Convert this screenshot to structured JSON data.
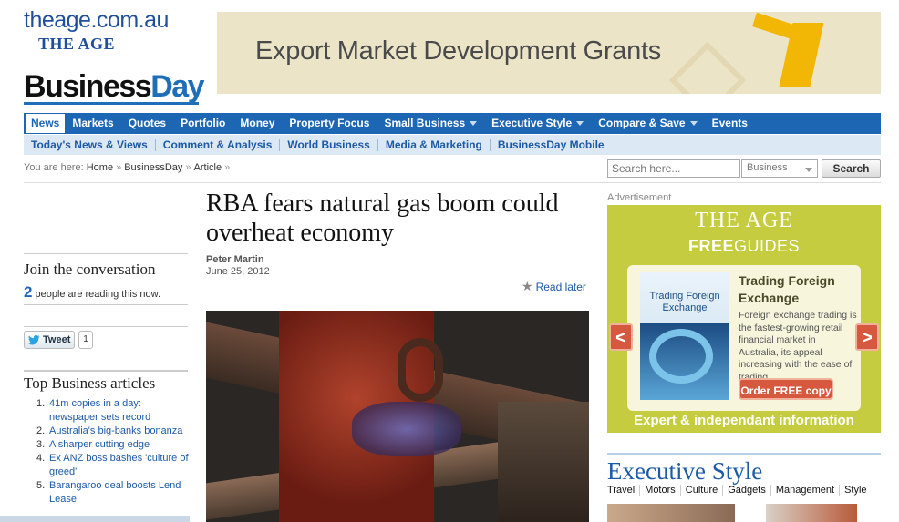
{
  "masthead": {
    "site": "theage.com.au",
    "paper": "THE AGE",
    "section_part1": "Business",
    "section_part2": "Day"
  },
  "banner": {
    "text": "Export Market Development Grants"
  },
  "nav_primary": [
    {
      "label": "News",
      "active": true,
      "dropdown": false
    },
    {
      "label": "Markets",
      "dropdown": false
    },
    {
      "label": "Quotes",
      "dropdown": false
    },
    {
      "label": "Portfolio",
      "dropdown": false
    },
    {
      "label": "Money",
      "dropdown": false
    },
    {
      "label": "Property Focus",
      "dropdown": false
    },
    {
      "label": "Small Business",
      "dropdown": true
    },
    {
      "label": "Executive Style",
      "dropdown": true
    },
    {
      "label": "Compare & Save",
      "dropdown": true
    },
    {
      "label": "Events",
      "dropdown": false
    }
  ],
  "nav_secondary": [
    "Today's News & Views",
    "Comment & Analysis",
    "World Business",
    "Media & Marketing",
    "BusinessDay Mobile"
  ],
  "breadcrumb": {
    "prefix": "You are here:",
    "items": [
      "Home",
      "BusinessDay",
      "Article"
    ],
    "sep": "»"
  },
  "search": {
    "placeholder": "Search here...",
    "scope": "Business",
    "button": "Search"
  },
  "conversation": {
    "title": "Join the conversation",
    "count": "2",
    "text": "people are reading this now."
  },
  "share": {
    "tweet_label": "Tweet",
    "tweet_count": "1"
  },
  "top_articles": {
    "title": "Top Business articles",
    "items": [
      {
        "n": "1.",
        "text": "41m copies in a day: newspaper sets record"
      },
      {
        "n": "2.",
        "text": "Australia's big-banks bonanza"
      },
      {
        "n": "3.",
        "text": "A sharper cutting edge"
      },
      {
        "n": "4.",
        "text": "Ex ANZ boss bashes 'culture of greed'"
      },
      {
        "n": "5.",
        "text": "Barangaroo deal boosts Lend Lease"
      }
    ]
  },
  "article": {
    "headline": "RBA fears natural gas boom could overheat economy",
    "author": "Peter Martin",
    "date": "June 25, 2012",
    "read_later": "Read later"
  },
  "advert": {
    "label": "Advertisement",
    "brand": "THE AGE",
    "free": "FREE",
    "guides": "GUIDES",
    "cover_title": "Trading Foreign Exchange",
    "title": "Trading Foreign Exchange",
    "description": "Foreign exchange trading is the fastest-growing retail financial market in Australia, its appeal increasing with the ease of trading...",
    "cta": "Order FREE copy",
    "prev": "<",
    "next": ">",
    "footer": "Expert & independant information",
    "accent": "#c5cc3f"
  },
  "executive_style": {
    "title": "Executive Style",
    "nav": [
      "Travel",
      "Motors",
      "Culture",
      "Gadgets",
      "Management",
      "Style"
    ]
  },
  "colors": {
    "nav_blue": "#1d66b4",
    "link_blue": "#1d5aa6"
  }
}
